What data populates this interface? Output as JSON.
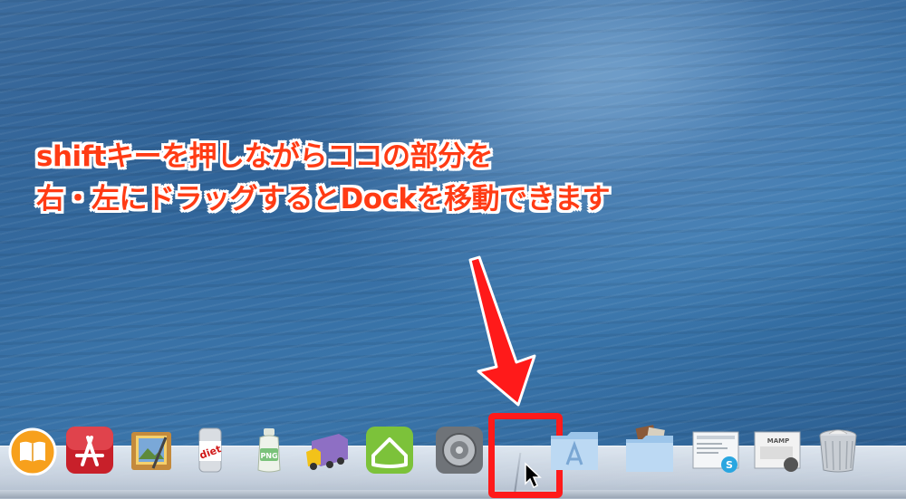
{
  "annotation": {
    "line1": "shiftキーを押しながらココの部分を",
    "line2": "右・左にドラッグするとDockを移動できます",
    "color": "#ff3b14"
  },
  "highlight": {
    "color": "#ff1a1a"
  },
  "dock": {
    "items": [
      {
        "name": "ibooks",
        "icon": "book-icon"
      },
      {
        "name": "app-store",
        "icon": "app-store-icon"
      },
      {
        "name": "preview",
        "icon": "preview-icon"
      },
      {
        "name": "jpegmini",
        "icon": "diet-can-icon",
        "label": "diet"
      },
      {
        "name": "pngmini",
        "icon": "png-bottle-icon",
        "label": "PNG"
      },
      {
        "name": "transmit",
        "icon": "truck-icon"
      },
      {
        "name": "home-app",
        "icon": "house-cloud-icon"
      },
      {
        "name": "system-preferences",
        "icon": "gear-icon"
      },
      {
        "name": "applications-folder",
        "icon": "applications-folder-icon"
      },
      {
        "name": "downloads-folder",
        "icon": "stack-folder-icon"
      },
      {
        "name": "screenshot-stack",
        "icon": "document-stack-icon"
      },
      {
        "name": "mamp-stack",
        "icon": "mamp-document-icon",
        "label": "MAMP"
      },
      {
        "name": "trash",
        "icon": "trash-icon"
      }
    ]
  }
}
